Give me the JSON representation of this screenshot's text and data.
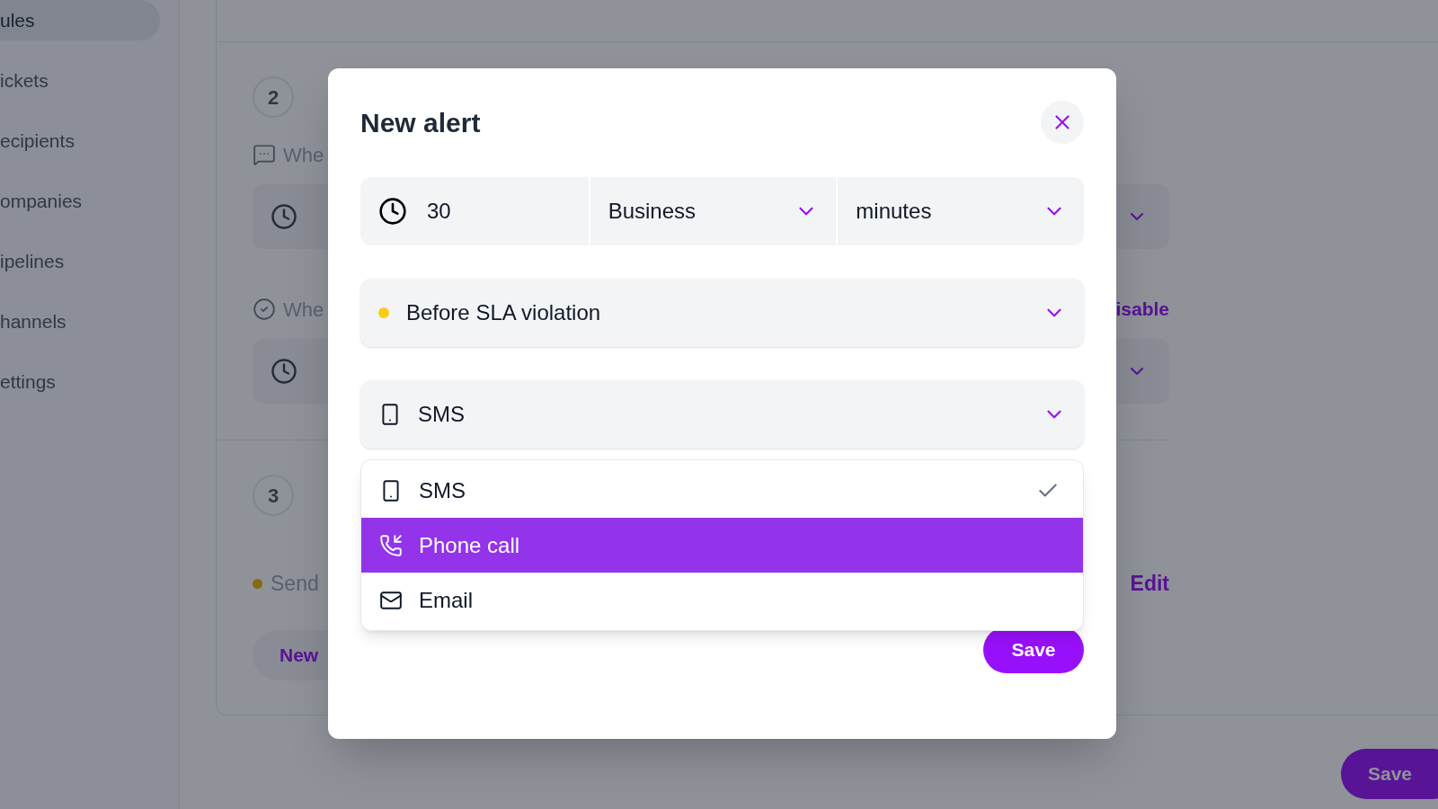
{
  "background": {
    "sidebar": [
      {
        "label": "ules",
        "selected": true
      },
      {
        "label": "ickets",
        "selected": false
      },
      {
        "label": "ecipients",
        "selected": false
      },
      {
        "label": "ompanies",
        "selected": false
      },
      {
        "label": "ipelines",
        "selected": false
      },
      {
        "label": "hannels",
        "selected": false
      },
      {
        "label": "ettings",
        "selected": false
      }
    ],
    "step_2": {
      "number": "2",
      "conditions": [
        {
          "kind": "message",
          "label": "Whe"
        },
        {
          "kind": "resolved",
          "label": "Whe",
          "action": "isable"
        }
      ]
    },
    "step_3": {
      "number": "3",
      "alert": {
        "label": "Send"
      },
      "edit": "Edit",
      "new_button": "New"
    },
    "save": "Save"
  },
  "modal": {
    "title": "New alert",
    "duration": "30",
    "hours_type": "Business",
    "unit": "minutes",
    "trigger": {
      "label": "Before SLA violation",
      "color": "#facc15"
    },
    "channel": {
      "label": "SMS"
    },
    "options": [
      {
        "kind": "sms",
        "label": "SMS",
        "selected": false,
        "checked": true
      },
      {
        "kind": "phone",
        "label": "Phone call",
        "selected": true,
        "checked": false
      },
      {
        "kind": "email",
        "label": "Email",
        "selected": false,
        "checked": false
      }
    ],
    "save": "Save"
  }
}
